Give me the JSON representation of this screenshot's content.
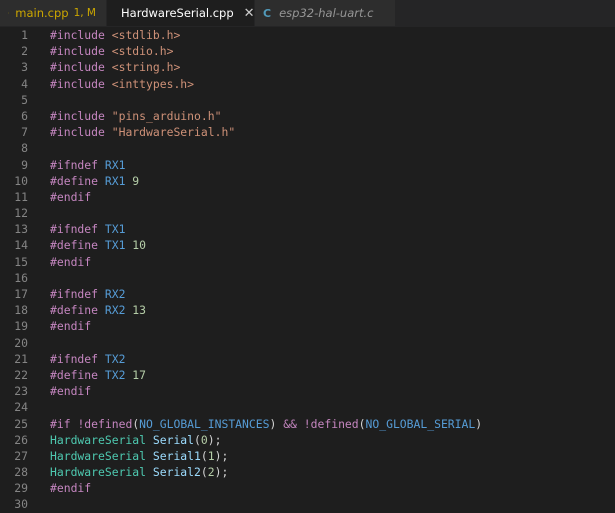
{
  "tabs": [
    {
      "name": "main.cpp",
      "badge": "1, M",
      "active": false,
      "icon": "cpp-icon"
    },
    {
      "name": "HardwareSerial.cpp",
      "close": "✕",
      "active": true,
      "icon": "cpp-icon"
    },
    {
      "name": "esp32-hal-uart.c",
      "active": false,
      "icon": "c-icon",
      "icon_text": "C"
    }
  ],
  "colors": {
    "background": "#1e1e1e",
    "keyword": "#c586c0",
    "string": "#ce9178",
    "macro": "#569cd6",
    "number": "#b5cea8",
    "type": "#4ec9b0",
    "identifier": "#9cdcfe",
    "modified": "#cca700"
  },
  "editor": {
    "lines": [
      {
        "n": "1",
        "t": [
          {
            "c": "kw",
            "s": "#include"
          },
          {
            "c": "str",
            "s": " <stdlib.h>"
          }
        ]
      },
      {
        "n": "2",
        "t": [
          {
            "c": "kw",
            "s": "#include"
          },
          {
            "c": "str",
            "s": " <stdio.h>"
          }
        ]
      },
      {
        "n": "3",
        "t": [
          {
            "c": "kw",
            "s": "#include"
          },
          {
            "c": "str",
            "s": " <string.h>"
          }
        ]
      },
      {
        "n": "4",
        "t": [
          {
            "c": "kw",
            "s": "#include"
          },
          {
            "c": "str",
            "s": " <inttypes.h>"
          }
        ]
      },
      {
        "n": "5",
        "t": []
      },
      {
        "n": "6",
        "t": [
          {
            "c": "kw",
            "s": "#include"
          },
          {
            "c": "str",
            "s": " \"pins_arduino.h\""
          }
        ]
      },
      {
        "n": "7",
        "t": [
          {
            "c": "kw",
            "s": "#include"
          },
          {
            "c": "str",
            "s": " \"HardwareSerial.h\""
          }
        ]
      },
      {
        "n": "8",
        "t": []
      },
      {
        "n": "9",
        "t": [
          {
            "c": "kw",
            "s": "#ifndef"
          },
          {
            "c": "mac",
            "s": " RX1"
          }
        ]
      },
      {
        "n": "10",
        "t": [
          {
            "c": "kw",
            "s": "#define"
          },
          {
            "c": "mac",
            "s": " RX1"
          },
          {
            "c": "num",
            "s": " 9"
          }
        ]
      },
      {
        "n": "11",
        "t": [
          {
            "c": "kw",
            "s": "#endif"
          }
        ]
      },
      {
        "n": "12",
        "t": []
      },
      {
        "n": "13",
        "t": [
          {
            "c": "kw",
            "s": "#ifndef"
          },
          {
            "c": "mac",
            "s": " TX1"
          }
        ]
      },
      {
        "n": "14",
        "t": [
          {
            "c": "kw",
            "s": "#define"
          },
          {
            "c": "mac",
            "s": " TX1"
          },
          {
            "c": "num",
            "s": " 10"
          }
        ]
      },
      {
        "n": "15",
        "t": [
          {
            "c": "kw",
            "s": "#endif"
          }
        ]
      },
      {
        "n": "16",
        "t": []
      },
      {
        "n": "17",
        "t": [
          {
            "c": "kw",
            "s": "#ifndef"
          },
          {
            "c": "mac",
            "s": " RX2"
          }
        ]
      },
      {
        "n": "18",
        "t": [
          {
            "c": "kw",
            "s": "#define"
          },
          {
            "c": "mac",
            "s": " RX2"
          },
          {
            "c": "num",
            "s": " 13"
          }
        ]
      },
      {
        "n": "19",
        "t": [
          {
            "c": "kw",
            "s": "#endif"
          }
        ]
      },
      {
        "n": "20",
        "t": []
      },
      {
        "n": "21",
        "t": [
          {
            "c": "kw",
            "s": "#ifndef"
          },
          {
            "c": "mac",
            "s": " TX2"
          }
        ]
      },
      {
        "n": "22",
        "t": [
          {
            "c": "kw",
            "s": "#define"
          },
          {
            "c": "mac",
            "s": " TX2"
          },
          {
            "c": "num",
            "s": " 17"
          }
        ]
      },
      {
        "n": "23",
        "t": [
          {
            "c": "kw",
            "s": "#endif"
          }
        ]
      },
      {
        "n": "24",
        "t": []
      },
      {
        "n": "25",
        "t": [
          {
            "c": "kw",
            "s": "#if"
          },
          {
            "c": "pun",
            "s": " "
          },
          {
            "c": "kw",
            "s": "!defined"
          },
          {
            "c": "pun",
            "s": "("
          },
          {
            "c": "mac",
            "s": "NO_GLOBAL_INSTANCES"
          },
          {
            "c": "pun",
            "s": ") "
          },
          {
            "c": "kw",
            "s": "&&"
          },
          {
            "c": "pun",
            "s": " "
          },
          {
            "c": "kw",
            "s": "!defined"
          },
          {
            "c": "pun",
            "s": "("
          },
          {
            "c": "mac",
            "s": "NO_GLOBAL_SERIAL"
          },
          {
            "c": "pun",
            "s": ")"
          }
        ]
      },
      {
        "n": "26",
        "t": [
          {
            "c": "typ",
            "s": "HardwareSerial"
          },
          {
            "c": "pun",
            "s": " "
          },
          {
            "c": "var",
            "s": "Serial"
          },
          {
            "c": "pun",
            "s": "("
          },
          {
            "c": "num",
            "s": "0"
          },
          {
            "c": "pun",
            "s": ");"
          }
        ]
      },
      {
        "n": "27",
        "t": [
          {
            "c": "typ",
            "s": "HardwareSerial"
          },
          {
            "c": "pun",
            "s": " "
          },
          {
            "c": "var",
            "s": "Serial1"
          },
          {
            "c": "pun",
            "s": "("
          },
          {
            "c": "num",
            "s": "1"
          },
          {
            "c": "pun",
            "s": ");"
          }
        ]
      },
      {
        "n": "28",
        "t": [
          {
            "c": "typ",
            "s": "HardwareSerial"
          },
          {
            "c": "pun",
            "s": " "
          },
          {
            "c": "var",
            "s": "Serial2"
          },
          {
            "c": "pun",
            "s": "("
          },
          {
            "c": "num",
            "s": "2"
          },
          {
            "c": "pun",
            "s": ");"
          }
        ]
      },
      {
        "n": "29",
        "t": [
          {
            "c": "kw",
            "s": "#endif"
          }
        ]
      },
      {
        "n": "30",
        "t": []
      }
    ]
  }
}
